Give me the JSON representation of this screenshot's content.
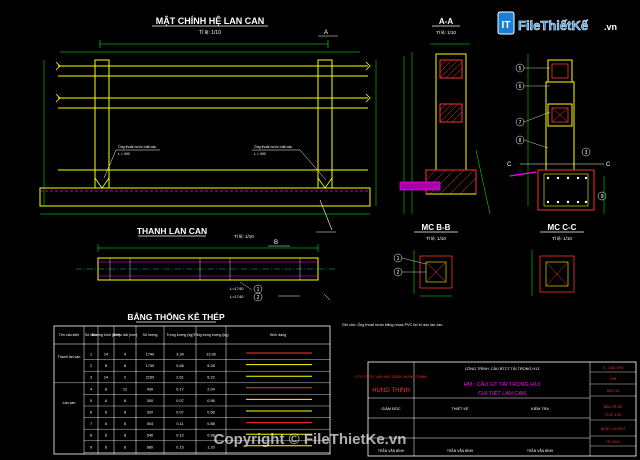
{
  "colors": {
    "background": "#000000",
    "outline_yellow": "#ffff00",
    "dim_green": "#00ff00",
    "cyan": "#00ffff",
    "magenta": "#ff00ff",
    "red_hatch": "#ff3030",
    "white": "#ffffff"
  },
  "views": {
    "elevation": {
      "title": "MẶT CHÍNH HỆ LAN CAN",
      "scale": "Tỉ lệ: 1/10",
      "section_marker": "A",
      "callout_left": "Ống thoát nước mặt cầu",
      "callout_left_value": "L = 400",
      "callout_right": "Ống thoát nước mặt cầu",
      "callout_right_value": "L = 400"
    },
    "section_aa": {
      "title": "A-A",
      "scale": "Tỉ lệ: 1/10"
    },
    "handrail": {
      "title": "THANH LAN CAN",
      "scale": "Tỉ lệ: 1/10",
      "section_marker": "B",
      "callout_1": "L=1740",
      "callout_2": "L=1740",
      "marker_1": "1",
      "marker_2": "2"
    },
    "section_bb": {
      "title": "MC B-B",
      "scale": "Tỉ lệ: 1/10",
      "marker_1": "1",
      "marker_2": "2"
    },
    "section_cc": {
      "title": "MC C-C",
      "scale": "Tỉ lệ: 1/10",
      "marker_c": "C",
      "markers": [
        "5",
        "6",
        "7",
        "8",
        "3",
        "4",
        "9"
      ]
    }
  },
  "steel_table": {
    "title": "BẢNG THỐNG KÊ THÉP",
    "headers": [
      "Tên cấu kiện",
      "Số hiệu",
      "Đường kính (mm)",
      "Chiều dài (mm)",
      "Số lượng",
      "Trọng lượng (kg)",
      "Tổng trọng lượng (kg)",
      "Hình dạng"
    ],
    "group_labels": [
      "Thanh lan can",
      "Lan can"
    ],
    "rows": [
      [
        "1",
        "14",
        "4",
        "1740",
        "3.34",
        "13.36"
      ],
      [
        "2",
        "8",
        "8",
        "1740",
        "0.66",
        "5.28"
      ],
      [
        "3",
        "14",
        "2",
        "2160",
        "2.61",
        "5.22"
      ],
      [
        "4",
        "8",
        "12",
        "430",
        "0.17",
        "2.04"
      ],
      [
        "5",
        "6",
        "8",
        "300",
        "0.07",
        "0.56"
      ],
      [
        "6",
        "6",
        "8",
        "320",
        "0.07",
        "0.56"
      ],
      [
        "7",
        "6",
        "8",
        "504",
        "0.11",
        "0.88"
      ],
      [
        "8",
        "6",
        "8",
        "540",
        "0.12",
        "0.96"
      ],
      [
        "9",
        "6",
        "8",
        "680",
        "0.15",
        "1.20"
      ]
    ]
  },
  "title_block": {
    "company": "CTY CP TƯ VẤN XÂY DỰNG HƯNG THỊNH",
    "company_short": "HUNG THINH",
    "project": "CÔNG TRÌNH: CẦU BTCT TẢI TRỌNG H13",
    "drawing_name_1": "HM : CẦU GT TẢI TRỌNG H13",
    "drawing_name_2": "CHI TIẾT LAN CAN",
    "roles": [
      "GIÁM ĐỐC",
      "THIẾT KẾ",
      "KIỂM TRA"
    ],
    "names": [
      "TRẦN VĂN BÌNH",
      "TRẦN VĂN BÌNH",
      "TRẦN VĂN BÌNH"
    ],
    "side_fields": [
      "TL: CẤU THO",
      "VH5",
      "REV: 00",
      "BẢN VẼ SỐ",
      "TỈ LỆ: 1/10",
      "NGÀY: 10/ 2017",
      "HT: 2012"
    ],
    "note": "Ghi chú: Ống thoát nước bằng nhựa PVC bố trí dọc lan can"
  },
  "logo": {
    "brand": "FileThiếtKế",
    "domain": ".vn",
    "mark": "IT"
  },
  "watermark": "Copyright © FileThietKe.vn"
}
